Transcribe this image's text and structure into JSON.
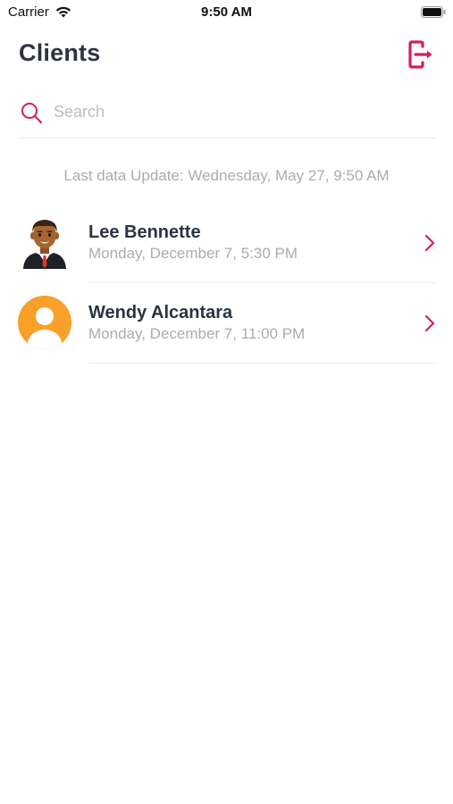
{
  "status_bar": {
    "carrier": "Carrier",
    "time": "9:50 AM"
  },
  "header": {
    "title": "Clients",
    "logout_icon": "logout-icon",
    "accent_color": "#d81b60"
  },
  "search": {
    "placeholder": "Search",
    "value": "",
    "icon": "search-icon"
  },
  "last_update": "Last data Update: Wednesday, May 27, 9:50 AM",
  "clients": [
    {
      "name": "Lee Bennette",
      "date": "Monday, December 7, 5:30 PM",
      "avatar": "man-in-suit-avatar"
    },
    {
      "name": "Wendy Alcantara",
      "date": "Monday, December 7, 11:00 PM",
      "avatar": "default-user-avatar",
      "avatar_color": "#f8a02a"
    }
  ]
}
